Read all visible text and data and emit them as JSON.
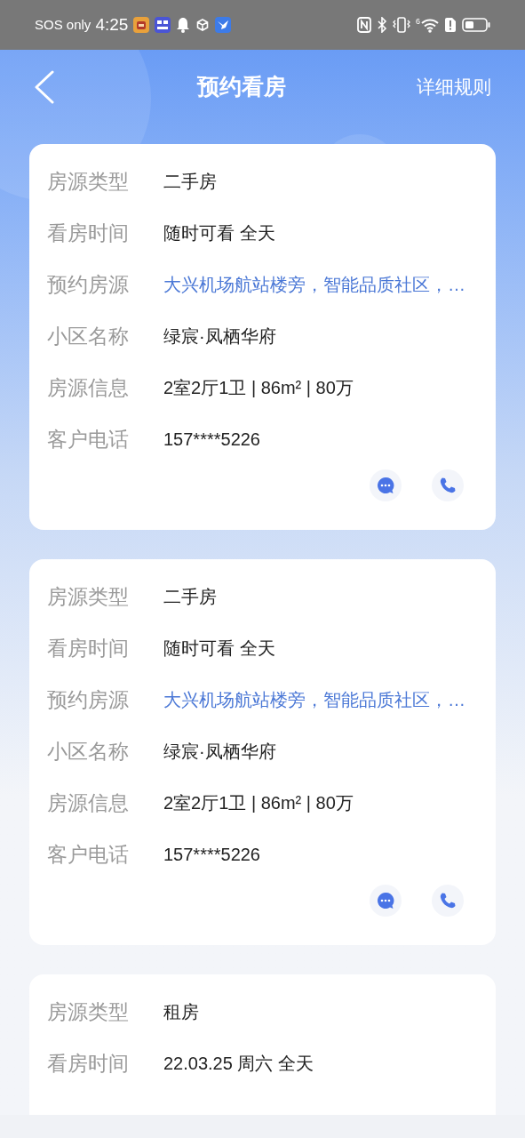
{
  "status_bar": {
    "carrier": "SOS only",
    "time": "4:25",
    "signal_label": "6"
  },
  "header": {
    "title": "预约看房",
    "action": "详细规则"
  },
  "cards": [
    {
      "show_actions": true,
      "fields": [
        {
          "label": "房源类型",
          "value": "二手房",
          "kind": "text"
        },
        {
          "label": "看房时间",
          "value": "随时可看 全天",
          "kind": "text"
        },
        {
          "label": "预约房源",
          "value": "大兴机场航站楼旁，智能品质社区，…",
          "kind": "link"
        },
        {
          "label": "小区名称",
          "value": "绿宸·凤栖华府",
          "kind": "text"
        },
        {
          "label": "房源信息",
          "value": "2室2厅1卫 | 86m² | 80万",
          "kind": "text"
        },
        {
          "label": "客户电话",
          "value": "157****5226",
          "kind": "text"
        }
      ]
    },
    {
      "show_actions": true,
      "fields": [
        {
          "label": "房源类型",
          "value": "二手房",
          "kind": "text"
        },
        {
          "label": "看房时间",
          "value": "随时可看 全天",
          "kind": "text"
        },
        {
          "label": "预约房源",
          "value": "大兴机场航站楼旁，智能品质社区，…",
          "kind": "link"
        },
        {
          "label": "小区名称",
          "value": "绿宸·凤栖华府",
          "kind": "text"
        },
        {
          "label": "房源信息",
          "value": "2室2厅1卫 | 86m² | 80万",
          "kind": "text"
        },
        {
          "label": "客户电话",
          "value": "157****5226",
          "kind": "text"
        }
      ]
    },
    {
      "show_actions": false,
      "fields": [
        {
          "label": "房源类型",
          "value": "租房",
          "kind": "text"
        },
        {
          "label": "看房时间",
          "value": "22.03.25 周六 全天",
          "kind": "text"
        }
      ]
    }
  ]
}
